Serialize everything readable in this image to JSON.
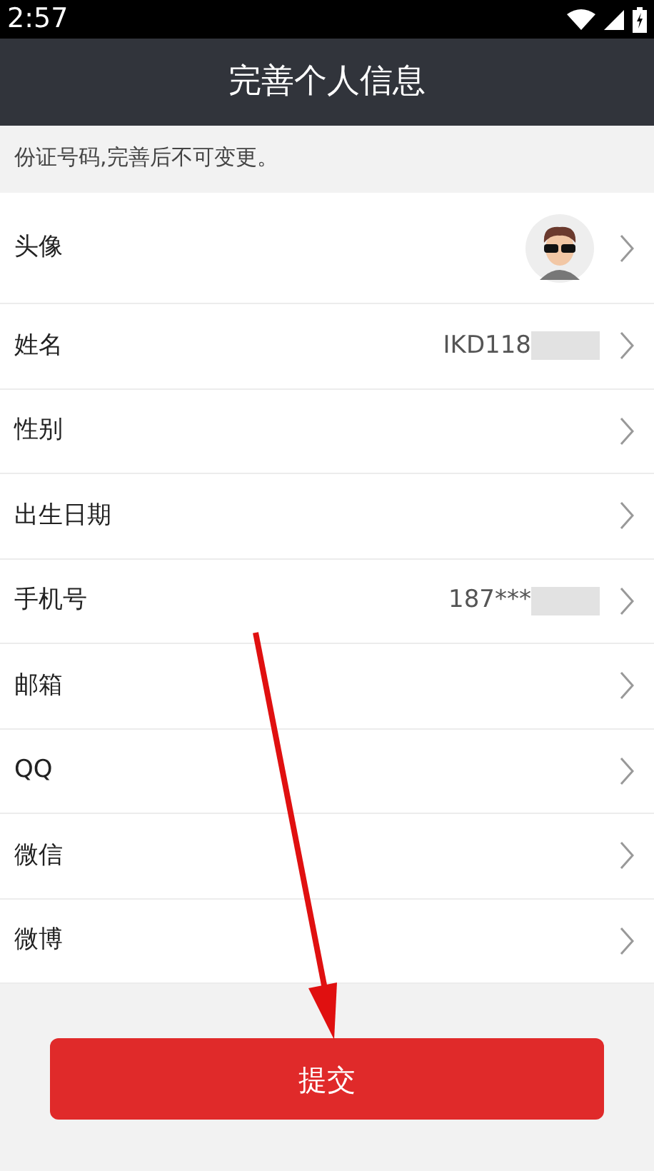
{
  "status_bar": {
    "time": "2:57"
  },
  "header": {
    "title": "完善个人信息"
  },
  "notice": "份证号码,完善后不可变更。",
  "rows": [
    {
      "kind": "avatar",
      "label": "头像"
    },
    {
      "kind": "value",
      "label": "姓名",
      "value": "IKD118",
      "masked": true
    },
    {
      "kind": "value",
      "label": "性别"
    },
    {
      "kind": "value",
      "label": "出生日期"
    },
    {
      "kind": "value",
      "label": "手机号",
      "value": "187***",
      "masked": true
    },
    {
      "kind": "value",
      "label": "邮箱"
    },
    {
      "kind": "value",
      "label": "QQ"
    },
    {
      "kind": "value",
      "label": "微信"
    },
    {
      "kind": "value",
      "label": "微博"
    }
  ],
  "submit_button": "提交"
}
